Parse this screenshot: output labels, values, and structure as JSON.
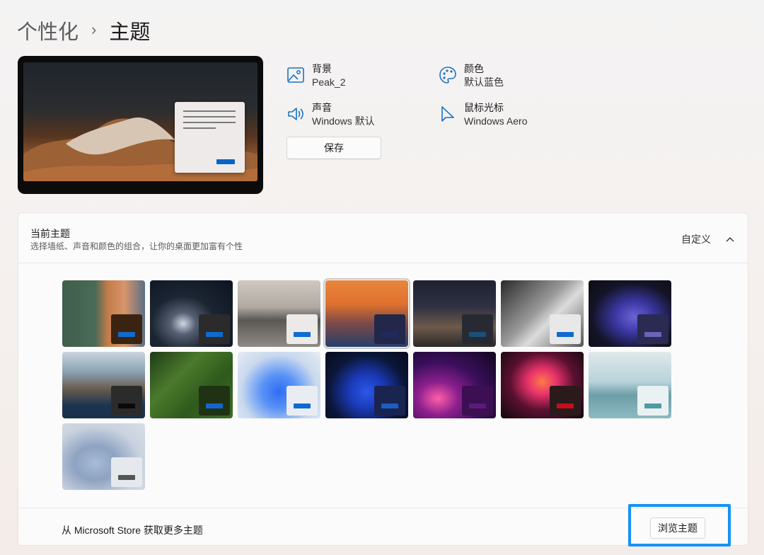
{
  "breadcrumb": {
    "parent": "个性化",
    "separator": "›",
    "current": "主题"
  },
  "properties": {
    "background": {
      "label": "背景",
      "value": "Peak_2",
      "icon": "image-icon"
    },
    "color": {
      "label": "颜色",
      "value": "默认蓝色",
      "icon": "palette-icon"
    },
    "sound": {
      "label": "声音",
      "value": "Windows 默认",
      "icon": "speaker-icon"
    },
    "cursor": {
      "label": "鼠标光标",
      "value": "Windows Aero",
      "icon": "cursor-icon"
    }
  },
  "save_label": "保存",
  "current_theme": {
    "title": "当前主题",
    "description": "选择墙纸、声音和颜色的组合，让你的桌面更加富有个性",
    "custom_label": "自定义",
    "themes": [
      {
        "bg": "linear-gradient(90deg,#3f5e4b 0%,#4a6b57 40%,#c27c4a 55%,#d8956a 75%,#5b6f86 100%)",
        "swatch": "#3a2411",
        "accent": "#0f6bd0"
      },
      {
        "bg": "radial-gradient(ellipse at 40% 65%,#cfd6e3 0%,#556072 18%,#1c2533 45%,#0c1320 100%)",
        "swatch": "#2b2b2b",
        "accent": "#0f6bd0"
      },
      {
        "bg": "linear-gradient(180deg,#cfc8c0 0%,#b1aaa2 40%,#5a5854 60%,#8f8b86 100%)",
        "swatch": "#eceae8",
        "accent": "#0f6bd0"
      },
      {
        "bg": "linear-gradient(180deg,#e8863f 0%,#e0722d 35%,#7a4a48 65%,#263e6b 100%)",
        "swatch": "#23284a",
        "accent": "#1f2a60"
      },
      {
        "bg": "linear-gradient(180deg,#1d2130 0%,#2f3143 40%,#6d5a4a 70%,#2c2a2a 100%)",
        "swatch": "#272a33",
        "accent": "#1a4f7a"
      },
      {
        "bg": "linear-gradient(135deg,#2a2a2a 0%,#9a9a9a 45%,#dcdcdc 60%,#555 100%)",
        "swatch": "#e8e8e8",
        "accent": "#0f6bd0"
      },
      {
        "bg": "radial-gradient(ellipse at 55% 55%,#6b64d6 0%,#3b37a2 30%,#141428 65%,#0c0c14 100%)",
        "swatch": "#2a2a52",
        "accent": "#6d63b8"
      },
      {
        "bg": "linear-gradient(180deg,#c9d4dd 0%,#8aa3b4 30%,#6a5e50 55%,#1e3550 80%,#183049 100%)",
        "swatch": "#2b2b2b",
        "accent": "#0a0a0a"
      },
      {
        "bg": "linear-gradient(135deg,#1f3b18 0%,#4a7a2c 35%,#2f5a1c 65%,#3c6b28 100%)",
        "swatch": "#1f3314",
        "accent": "#1366cf"
      },
      {
        "bg": "radial-gradient(ellipse at 50% 60%,#2f6cf2 0%,#5a93f6 30%,#c9d9ee 65%,#e6ecf2 100%)",
        "swatch": "#e9edf3",
        "accent": "#0f6bd0"
      },
      {
        "bg": "radial-gradient(ellipse at 50% 60%,#2b58e8 0%,#1a3ab8 30%,#0b1638 65%,#060b1c 100%)",
        "swatch": "#1a2450",
        "accent": "#1a5ec2"
      },
      {
        "bg": "radial-gradient(ellipse at 30% 70%,#ff5fa8 0%,#8c1f8d 25%,#3a0f5c 55%,#12061e 100%)",
        "swatch": "#3b0f52",
        "accent": "#5a1b7a"
      },
      {
        "bg": "radial-gradient(ellipse at 50% 45%,#ff7a4a 0%,#e6326a 25%,#5a1030 55%,#0e0a0c 100%)",
        "swatch": "#2a1a1c",
        "accent": "#c50e1b"
      },
      {
        "bg": "linear-gradient(180deg,#dfe9ec 0%,#b8d3da 45%,#6d9ea8 65%,#8dbac2 100%)",
        "swatch": "#eaf1f2",
        "accent": "#4f9aa4"
      },
      {
        "bg": "radial-gradient(ellipse at 40% 60%,#a8bbd6 0%,#8ea3c2 30%,#c9d2df 65%,#d9dee5 100%)",
        "swatch": "#e5e8ed",
        "accent": "#545454"
      }
    ]
  },
  "store_text": "从 Microsoft Store 获取更多主题",
  "browse_label": "浏览主题"
}
